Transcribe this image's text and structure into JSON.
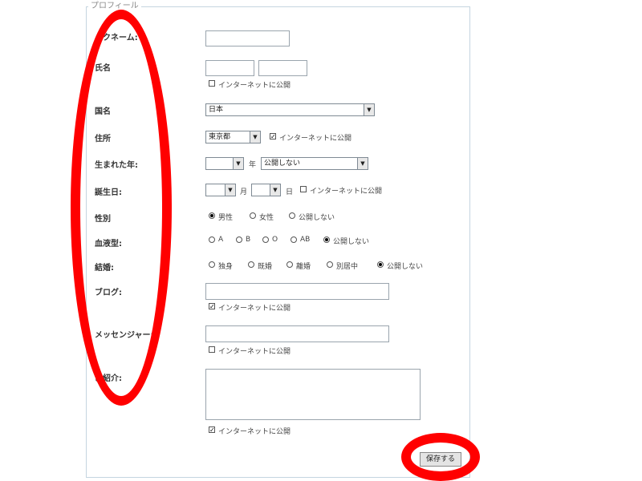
{
  "form": {
    "legend": "プロフィール",
    "labels": {
      "nickname": "ックネーム:",
      "name": "氏名",
      "country": "国名",
      "address": "住所",
      "birth_year": "生まれた年:",
      "birthday": "誕生日:",
      "gender": "性別",
      "blood": "血液型:",
      "marriage": "結婚:",
      "blog": "ブログ:",
      "messenger": "メッセンジャー:",
      "intro": "己紹介:"
    },
    "publish_label": "インターネットに公開",
    "country_value": "日本",
    "prefecture_value": "東京都",
    "birth_year_value": "",
    "year_suffix": "年",
    "birth_year_visibility": "公開しない",
    "month_value": "",
    "month_suffix": "月",
    "day_value": "",
    "day_suffix": "日",
    "gender_options": [
      "男性",
      "女性",
      "公開しない"
    ],
    "gender_selected": "男性",
    "blood_options": [
      "A",
      "B",
      "O",
      "AB",
      "公開しない"
    ],
    "blood_selected": "公開しない",
    "marriage_options": [
      "独身",
      "既婚",
      "離婚",
      "別居中",
      "公開しない"
    ],
    "marriage_selected": "公開しない",
    "name_publish_checked": false,
    "address_publish_checked": true,
    "blog_publish_checked": true,
    "messenger_publish_checked": false,
    "intro_publish_checked": true,
    "save_label": "保存する",
    "highlight_color": "#ff0000"
  }
}
